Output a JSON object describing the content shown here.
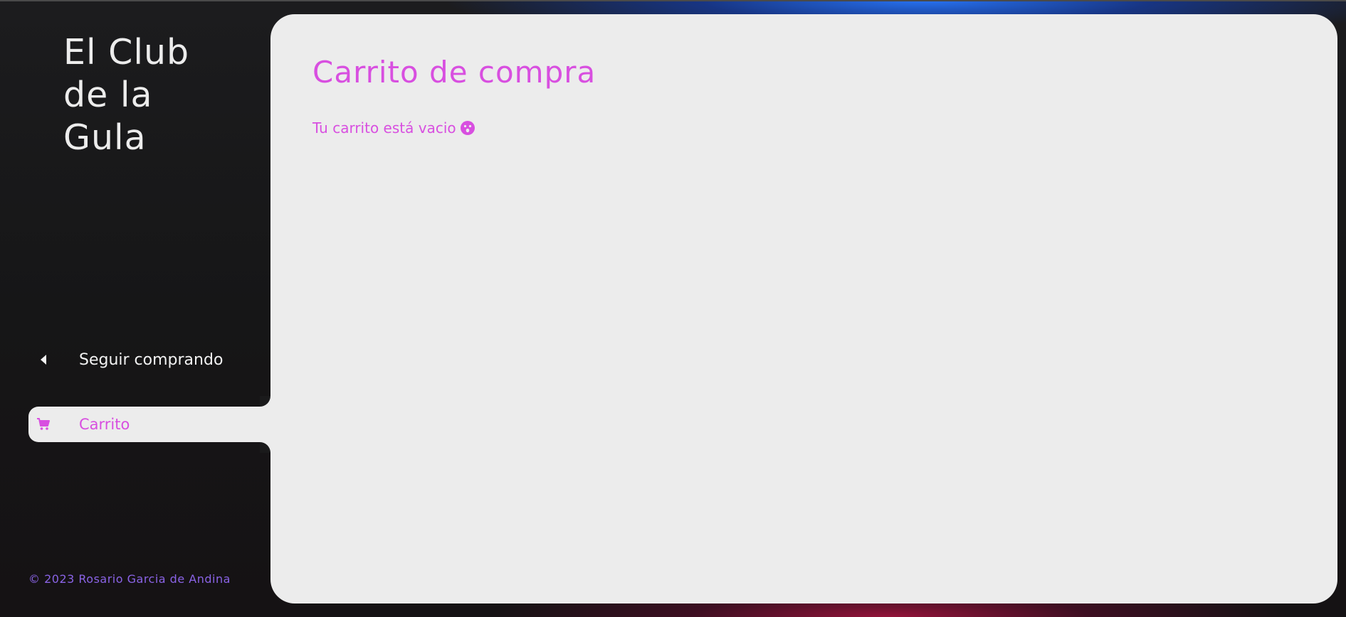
{
  "sidebar": {
    "brand_title": "El Club de la Gula",
    "nav": {
      "back_label": "Seguir comprando",
      "back_icon": "caret-left-icon",
      "cart_label": "Carrito",
      "cart_icon": "cart-icon"
    },
    "footer": "© 2023 Rosario Garcia de Andina"
  },
  "main": {
    "title": "Carrito de compra",
    "empty_message": "Tu carrito está vacio",
    "empty_icon": "surprised-face-icon"
  },
  "colors": {
    "accent": "#d84fe0",
    "footer": "#8a63e6",
    "panel": "#ececec",
    "sidebar_bg": "#1a1a1b"
  }
}
